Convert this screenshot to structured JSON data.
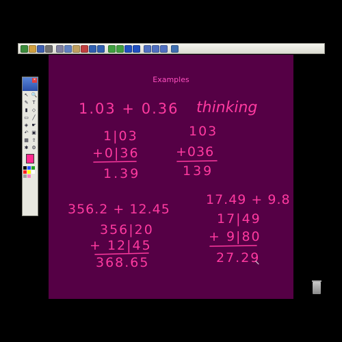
{
  "toolbar": {
    "buttons": [
      {
        "icon": "new-page-icon",
        "color": "#3c8c3c"
      },
      {
        "icon": "open-icon",
        "color": "#d0a040"
      },
      {
        "icon": "save-icon",
        "color": "#4060b0"
      },
      {
        "icon": "print-icon",
        "color": "#707070"
      },
      {
        "icon": "cut-icon",
        "color": "#8080a0"
      },
      {
        "icon": "copy-icon",
        "color": "#6080c0"
      },
      {
        "icon": "paste-icon",
        "color": "#c0a060"
      },
      {
        "icon": "delete-icon",
        "color": "#c04040"
      },
      {
        "icon": "undo-icon",
        "color": "#3060b0"
      },
      {
        "icon": "redo-icon",
        "color": "#3060b0"
      },
      {
        "icon": "screen-shade-icon",
        "color": "#40a040"
      },
      {
        "icon": "previous-page-icon",
        "color": "#40a040"
      },
      {
        "icon": "back-icon",
        "color": "#2050c0"
      },
      {
        "icon": "forward-icon",
        "color": "#2050c0"
      },
      {
        "icon": "zoom-in-icon",
        "color": "#5070c0"
      },
      {
        "icon": "zoom-out-icon",
        "color": "#5070c0"
      },
      {
        "icon": "zoom-fit-icon",
        "color": "#5070c0"
      },
      {
        "icon": "display-icon",
        "color": "#4070b0"
      }
    ]
  },
  "board": {
    "title": "Examples",
    "ink_color": "#ff3aa0",
    "background": "#550045",
    "problem1": {
      "expression": "1.03 + 0.36",
      "note": "thinking"
    },
    "work1": {
      "row1": "1|03",
      "row2": "+0|36",
      "result": "1.39"
    },
    "work2": {
      "row1": "103",
      "row2": "+036",
      "result": "139"
    },
    "problem2": {
      "expression": "356.2 + 12.45"
    },
    "work3": {
      "row1": "356|20",
      "row2": "+ 12|45",
      "result": "368.65"
    },
    "problem3": {
      "expression": "17.49 + 9.8"
    },
    "work4": {
      "row1": "17|49",
      "row2": "+ 9|80",
      "result": "27.29"
    }
  },
  "palette": {
    "selected_color": "#ff2a8e",
    "tools": [
      "select-icon",
      "magnify-icon",
      "pen-icon",
      "text-icon",
      "highlighter-icon",
      "shape-icon",
      "eraser-icon",
      "line-icon",
      "fill-icon",
      "pointer-icon",
      "undo-icon",
      "image-icon",
      "capture-icon",
      "export-icon",
      "stamp-icon",
      "settings-icon"
    ],
    "swatches": [
      "#000000",
      "#2050ff",
      "#20a020",
      "#ff2020",
      "#ffff00",
      "#ffffff",
      "#a0a0a0",
      "#ff80c0"
    ]
  }
}
